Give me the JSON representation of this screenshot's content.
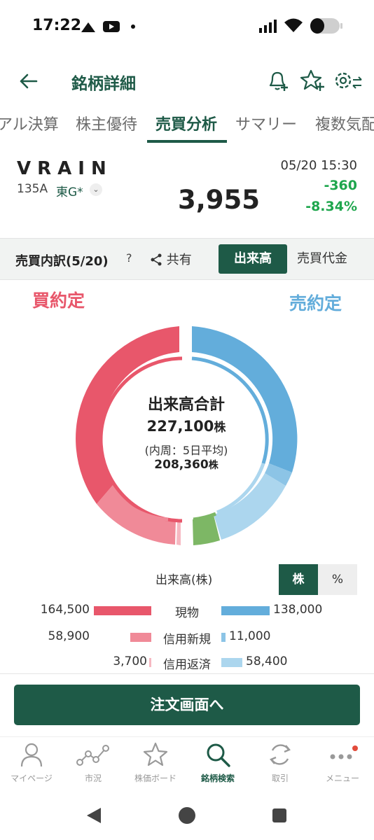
{
  "status_bar": {
    "time": "17:22"
  },
  "header": {
    "title": "銘柄詳細"
  },
  "tabs": [
    {
      "label": "アル決算"
    },
    {
      "label": "株主優待"
    },
    {
      "label": "売買分析"
    },
    {
      "label": "サマリー"
    },
    {
      "label": "複数気配"
    }
  ],
  "stock": {
    "ticker": "VRAIN",
    "code": "135A",
    "market": "東G*",
    "price": "3,955",
    "datetime": "05/20 15:30",
    "change": "-360",
    "change_pct": "-8.34%"
  },
  "breakdown": {
    "title": "売買内訳(5/20)",
    "help": "?",
    "share": "共有",
    "toggle_volume": "出来高",
    "toggle_value": "売買代金"
  },
  "chart_labels": {
    "buy": "買約定",
    "sell": "売約定"
  },
  "chart_center": {
    "title": "出来高合計",
    "total": "227,100",
    "total_unit": "株",
    "inner_note": "(内周：5日平均)",
    "inner_total": "208,360",
    "inner_unit": "株"
  },
  "chart_data": {
    "type": "pie",
    "series": [
      {
        "name": "現物",
        "side": "buy",
        "value": 164500,
        "color": "#e8576b"
      },
      {
        "name": "信用新規",
        "side": "buy",
        "value": 58900,
        "color": "#f08a98"
      },
      {
        "name": "信用返済",
        "side": "buy",
        "value": 3700,
        "color": "#f6b8c1"
      },
      {
        "name": "現物",
        "side": "sell",
        "value": 138000,
        "color": "#63addb"
      },
      {
        "name": "信用新規",
        "side": "sell",
        "value": 11000,
        "color": "#8cc4e6"
      },
      {
        "name": "信用返済",
        "side": "sell",
        "value": 58400,
        "color": "#acd6ee"
      }
    ],
    "other_color": "#7db765"
  },
  "legend": {
    "unit_label": "出来高(株)",
    "unit_shares": "株",
    "unit_percent": "%",
    "rows": [
      {
        "name": "現物",
        "buy": "164,500",
        "sell": "138,000"
      },
      {
        "name": "信用新規",
        "buy": "58,900",
        "sell": "11,000"
      },
      {
        "name": "信用返済",
        "buy": "3,700",
        "sell": "58,400"
      }
    ]
  },
  "order_button": "注文画面へ",
  "bottom_nav": [
    {
      "label": "マイページ"
    },
    {
      "label": "市況"
    },
    {
      "label": "株価ボード"
    },
    {
      "label": "銘柄検索"
    },
    {
      "label": "取引"
    },
    {
      "label": "メニュー"
    }
  ]
}
